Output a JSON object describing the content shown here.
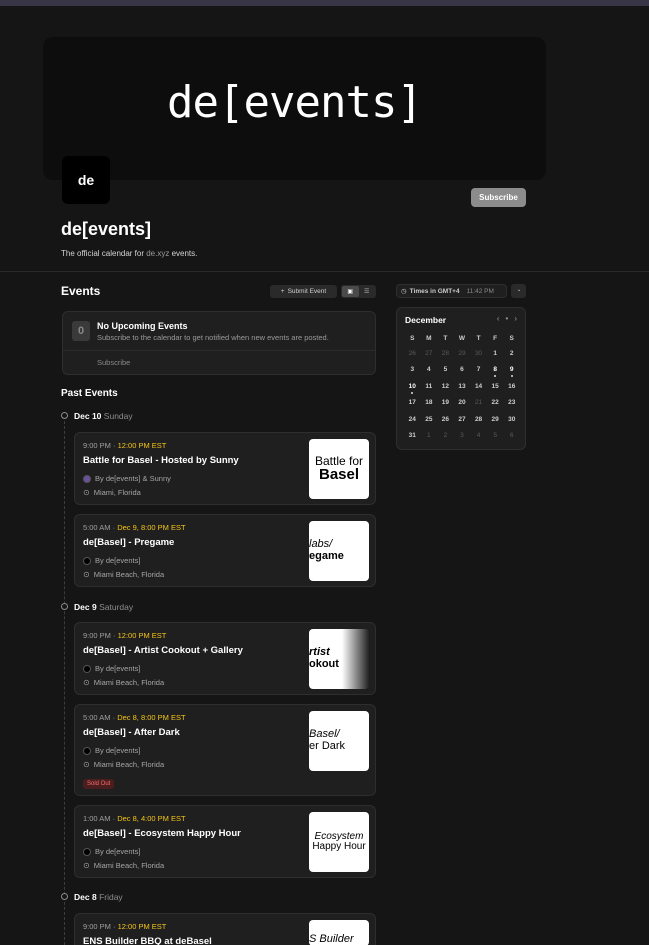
{
  "banner": {
    "logo": "de[events]"
  },
  "profile": {
    "avatar_text": "de",
    "subscribe_label": "Subscribe",
    "title": "de[events]",
    "desc_prefix": "The official calendar for ",
    "desc_link": "de.xyz",
    "desc_suffix": " events."
  },
  "events_section": {
    "heading": "Events",
    "submit_label": "Submit Event",
    "view_icons": [
      "grid-icon",
      "list-icon"
    ]
  },
  "no_upcoming": {
    "icon_text": "0",
    "title": "No Upcoming Events",
    "desc": "Subscribe to the calendar to get notified when new events are posted.",
    "subscribe_label": "Subscribe"
  },
  "past": {
    "heading": "Past Events",
    "groups": [
      {
        "date": "Dec 10",
        "weekday": "Sunday"
      },
      {
        "date": "Dec 9",
        "weekday": "Saturday"
      },
      {
        "date": "Dec 8",
        "weekday": "Friday"
      }
    ],
    "events": [
      {
        "time": "9:00 PM · ",
        "time_hl": "12:00 PM EST",
        "title": "Battle for Basel - Hosted by Sunny",
        "host": "By de[events] & Sunny",
        "location": "Miami, Florida",
        "thumb_l1": "Battle for",
        "thumb_l2": "Basel"
      },
      {
        "time": "5:00 AM · ",
        "time_hl": "Dec 9, 8:00 PM EST",
        "title": "de[Basel] - Pregame",
        "host": "By de[events]",
        "location": "Miami Beach, Florida",
        "thumb_l1": "labs/",
        "thumb_l2": "egame"
      },
      {
        "time": "9:00 PM · ",
        "time_hl": "12:00 PM EST",
        "title": "de[Basel] - Artist Cookout + Gallery",
        "host": "By de[events]",
        "location": "Miami Beach, Florida",
        "thumb_l1": "rtist",
        "thumb_l2": "okout"
      },
      {
        "time": "5:00 AM · ",
        "time_hl": "Dec 8, 8:00 PM EST",
        "title": "de[Basel] - After Dark",
        "host": "By de[events]",
        "location": "Miami Beach, Florida",
        "thumb_l1": "Basel/",
        "thumb_l2": "er Dark",
        "badge": "Sold Out"
      },
      {
        "time": "1:00 AM · ",
        "time_hl": "Dec 8, 4:00 PM EST",
        "title": "de[Basel] - Ecosystem Happy Hour",
        "host": "By de[events]",
        "location": "Miami Beach, Florida",
        "thumb_l1": "Ecosystem",
        "thumb_l2": "Happy Hour"
      },
      {
        "time": "9:00 PM · ",
        "time_hl": "12:00 PM EST",
        "title": "ENS Builder BBQ at deBasel",
        "thumb_l1": "S Builder"
      }
    ]
  },
  "sidebar": {
    "tz_label": "Times in GMT+4",
    "tz_time": "11:42 PM",
    "month": "December",
    "weekdays": [
      "S",
      "M",
      "T",
      "W",
      "T",
      "F",
      "S"
    ],
    "days": [
      {
        "d": "26",
        "m": true
      },
      {
        "d": "27",
        "m": true
      },
      {
        "d": "28",
        "m": true
      },
      {
        "d": "29",
        "m": true
      },
      {
        "d": "30",
        "m": true
      },
      {
        "d": "1"
      },
      {
        "d": "2"
      },
      {
        "d": "3"
      },
      {
        "d": "4"
      },
      {
        "d": "5"
      },
      {
        "d": "6"
      },
      {
        "d": "7"
      },
      {
        "d": "8",
        "e": true
      },
      {
        "d": "9",
        "e": true
      },
      {
        "d": "10",
        "e": true
      },
      {
        "d": "11"
      },
      {
        "d": "12"
      },
      {
        "d": "13"
      },
      {
        "d": "14"
      },
      {
        "d": "15"
      },
      {
        "d": "16"
      },
      {
        "d": "17"
      },
      {
        "d": "18"
      },
      {
        "d": "19"
      },
      {
        "d": "20"
      },
      {
        "d": "21",
        "m": true
      },
      {
        "d": "22"
      },
      {
        "d": "23"
      },
      {
        "d": "24"
      },
      {
        "d": "25"
      },
      {
        "d": "26"
      },
      {
        "d": "27"
      },
      {
        "d": "28"
      },
      {
        "d": "29"
      },
      {
        "d": "30"
      },
      {
        "d": "31"
      },
      {
        "d": "1",
        "m": true
      },
      {
        "d": "2",
        "m": true
      },
      {
        "d": "3",
        "m": true
      },
      {
        "d": "4",
        "m": true
      },
      {
        "d": "5",
        "m": true
      },
      {
        "d": "6",
        "m": true
      }
    ]
  }
}
